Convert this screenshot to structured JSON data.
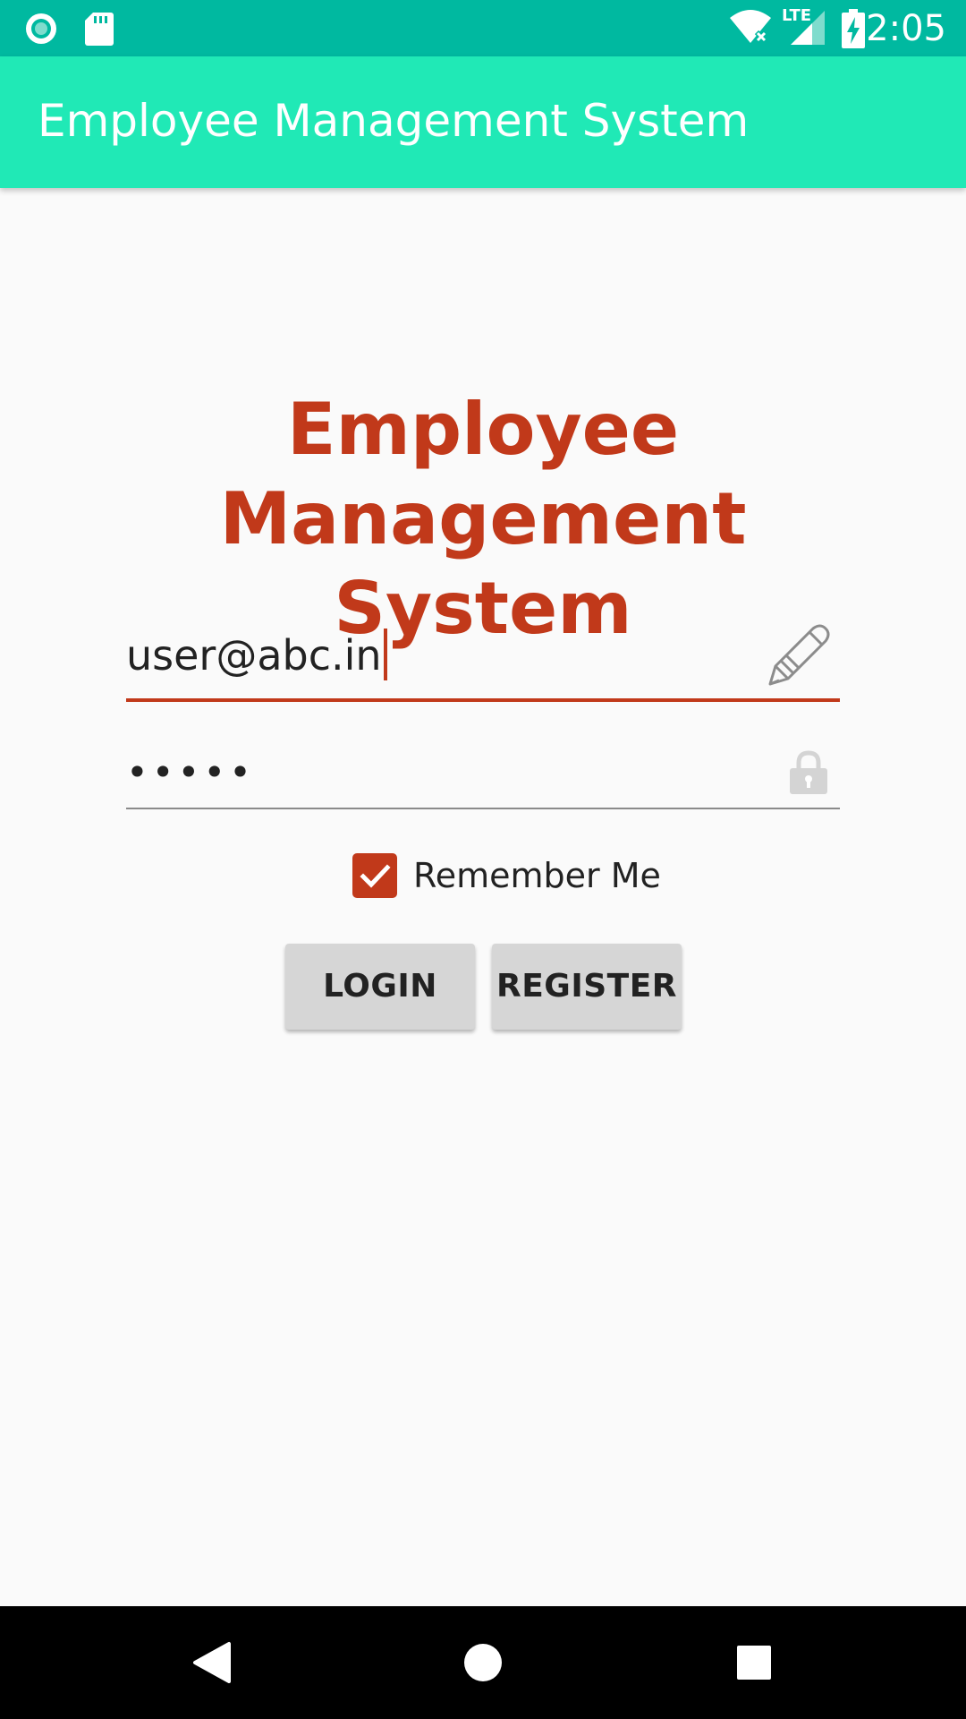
{
  "status_bar": {
    "time": "2:05",
    "left_icons": [
      "notification-circle-icon",
      "sd-card-icon"
    ],
    "right_icons": [
      "wifi-icon",
      "lte-signal-icon",
      "battery-charging-icon"
    ],
    "network_label": "LTE",
    "color": "#00b9a0"
  },
  "app_bar": {
    "title": "Employee Management System",
    "color": "#20e9b6"
  },
  "login": {
    "heading_line1": "Employee Management",
    "heading_line2": "System",
    "email_value": "user@abc.in",
    "email_icon": "pencil-icon",
    "password_value": "•••••",
    "password_icon": "lock-icon",
    "remember_label": "Remember Me",
    "remember_checked": true,
    "login_label": "LOGIN",
    "register_label": "REGISTER",
    "accent_color": "#c1391a"
  },
  "nav_bar": {
    "buttons": [
      "back-icon",
      "home-icon",
      "recents-icon"
    ]
  }
}
